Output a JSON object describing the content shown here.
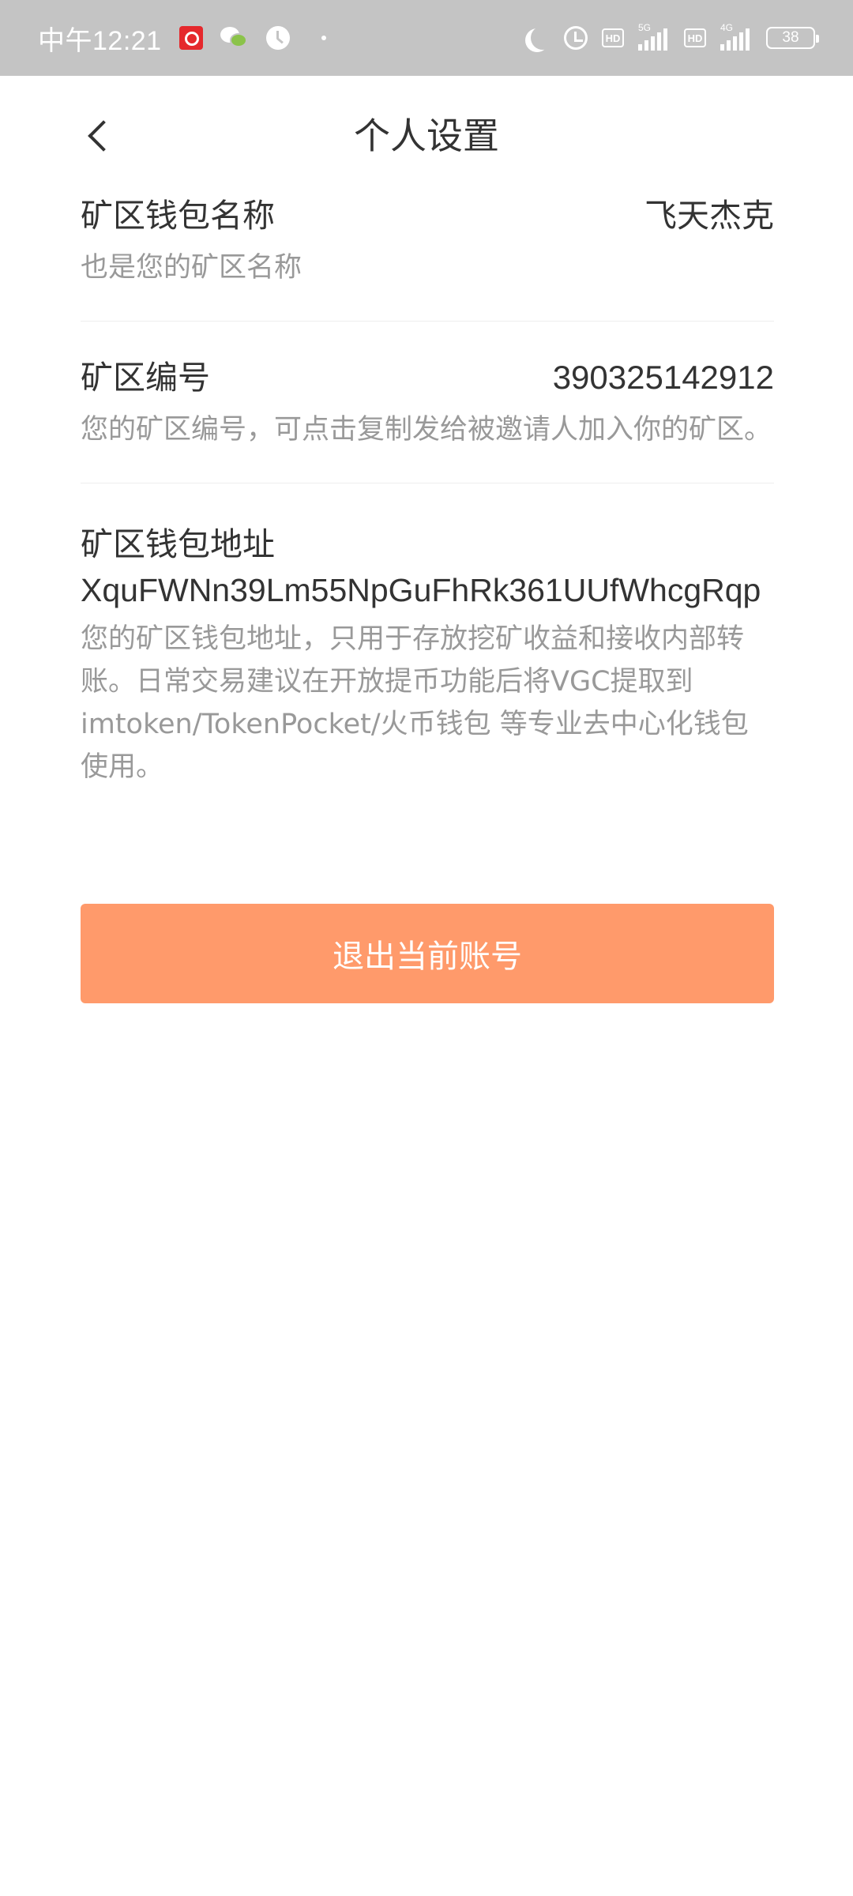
{
  "status_bar": {
    "time": "中午12:21",
    "icons_left": [
      "netease-music-icon",
      "wechat-icon",
      "clock-icon",
      "dot-icon"
    ],
    "icons_right": [
      "moon-icon",
      "alarm-icon",
      "hd-icon",
      "signal-5g-icon",
      "hd-icon",
      "signal-4g-icon",
      "battery-icon"
    ],
    "hd_label": "HD",
    "signal_5g_label": "5G",
    "signal_4g_label": "4G",
    "battery_level": "38"
  },
  "header": {
    "back_icon": "chevron-left-icon",
    "title": "个人设置"
  },
  "settings": {
    "wallet_name": {
      "label": "矿区钱包名称",
      "value": "飞天杰克",
      "description": "也是您的矿区名称"
    },
    "mine_code": {
      "label": "矿区编号",
      "value": "390325142912",
      "description": "您的矿区编号，可点击复制发给被邀请人加入你的矿区。"
    },
    "wallet_address": {
      "label": "矿区钱包地址",
      "value": "XquFWNn39Lm55NpGuFhRk361UUfWhcgRqp",
      "description": "您的矿区钱包地址，只用于存放挖矿收益和接收内部转账。日常交易建议在开放提币功能后将VGC提取到imtoken/TokenPocket/火币钱包 等专业去中心化钱包使用。"
    }
  },
  "actions": {
    "logout_label": "退出当前账号"
  },
  "colors": {
    "status_bar_bg": "#c4c4c4",
    "primary_text": "#333333",
    "secondary_text": "#999999",
    "logout_button_bg": "#ff9a6b",
    "divider": "#eeeeee"
  }
}
